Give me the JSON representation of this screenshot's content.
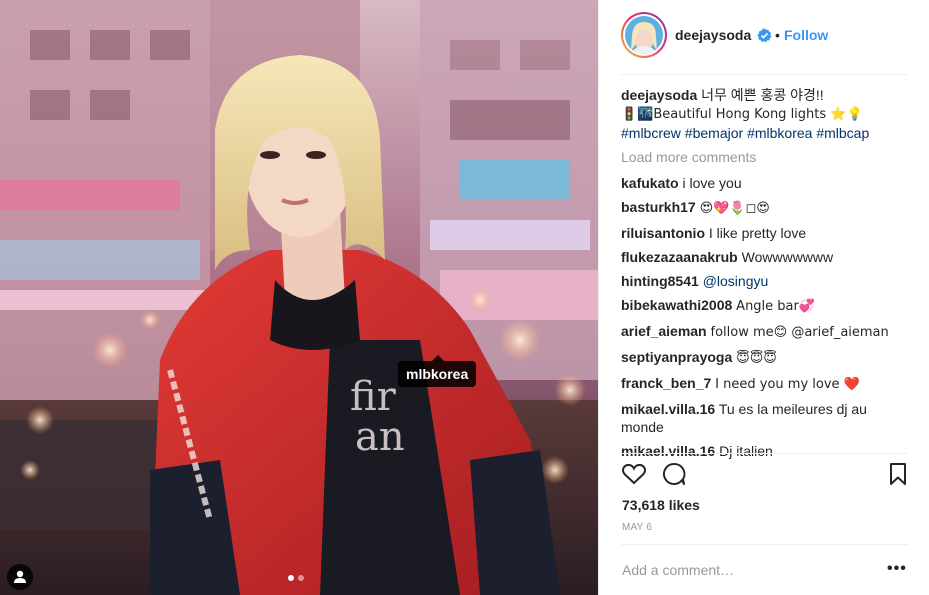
{
  "post": {
    "image_tag": "mlbkorea",
    "carousel_pages": 2,
    "carousel_active": 1
  },
  "header": {
    "username": "deejaysoda",
    "separator": "•",
    "follow_label": "Follow"
  },
  "caption": {
    "username": "deejaysoda",
    "line1": "너무 예쁜 홍콩 야경!!",
    "line2": "🚦🌃Beautiful Hong Kong lights ⭐️💡",
    "hashtags": [
      "#mlbcrew",
      "#bemajor",
      "#mlbkorea",
      "#mlbcap"
    ]
  },
  "load_more": "Load more comments",
  "comments": [
    {
      "user": "kafukato",
      "text": "i love you"
    },
    {
      "user": "basturkh17",
      "text": "😍💖🌷◻😍"
    },
    {
      "user": "riluisantonio",
      "text": "I like pretty love"
    },
    {
      "user": "flukezazaanakrub",
      "text": "Wowwwwwww"
    },
    {
      "user": "hinting8541",
      "text": "@losingyu"
    },
    {
      "user": "bibekawathi2008",
      "text": "Angle bar💞"
    },
    {
      "user": "arief_aieman",
      "text": "follow me😊 @arief_aieman"
    },
    {
      "user": "septiyanprayoga",
      "text": "😇😇😇"
    },
    {
      "user": "franck_ben_7",
      "text": "I need you my love ❤️"
    },
    {
      "user": "mikael.villa.16",
      "text": "Tu es la meileures dj au monde"
    },
    {
      "user": "mikael.villa.16",
      "text": "Dj italien"
    }
  ],
  "likes": "73,618 likes",
  "date": "MAY 6",
  "add_comment_placeholder": "Add a comment…",
  "more_label": "•••",
  "icons": {
    "like": "heart-icon",
    "comment": "comment-bubble-icon",
    "save": "bookmark-icon",
    "verified": "verified-badge-icon",
    "user_tags": "user-tag-icon"
  },
  "colors": {
    "link_blue": "#3897f0",
    "hashtag": "#003569",
    "muted": "#999999",
    "border": "#efefef"
  }
}
